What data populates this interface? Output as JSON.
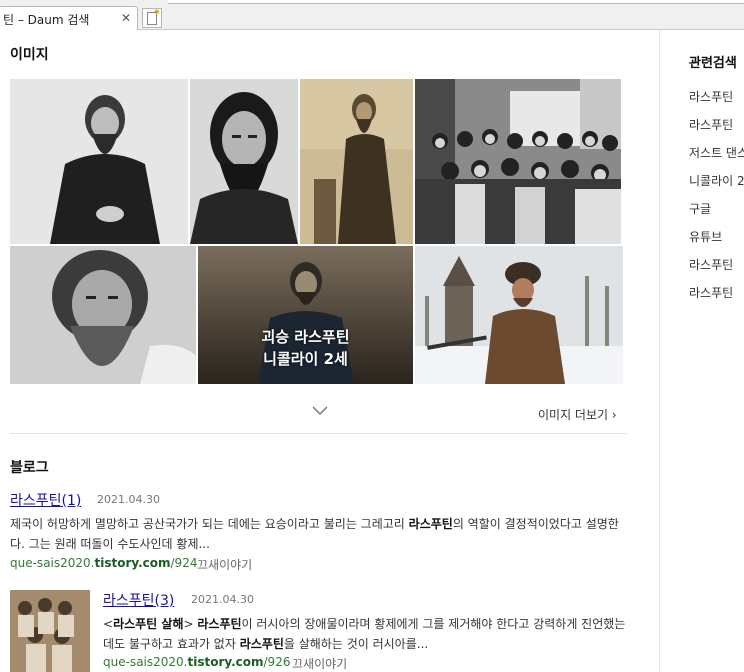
{
  "browser": {
    "tab_title": "틴 – Daum 검색",
    "tab_close": "✕"
  },
  "images_section": {
    "title": "이미지",
    "overlay_line1": "괴승 라스푸틴",
    "overlay_line2": "니콜라이 2세",
    "expand_icon": "chevron-down-icon",
    "more_label": "이미지 더보기 ›"
  },
  "blog_section": {
    "title": "블로그",
    "posts": [
      {
        "title": "라스푸틴(1)",
        "date": "2021.04.30",
        "snippet": [
          {
            "t": "제국이 허망하게 멸망하고 공산국가가 되는 데에는 요승이라고 불리는 그레고리 ",
            "b": false
          },
          {
            "t": "라스푸틴",
            "b": true
          },
          {
            "t": "의 역할이 결정적이었다고 설명한다. 그는 원래 떠돌이 수도사인데 황제...",
            "b": false
          }
        ],
        "url_prefix": "que-sais2020.",
        "url_domain": "tistory.com",
        "url_path": "/924",
        "author": "끄새이야기"
      },
      {
        "title": "라스푸틴(3)",
        "date": "2021.04.30",
        "snippet": [
          {
            "t": "<",
            "b": false
          },
          {
            "t": "라스푸틴 살해",
            "b": true
          },
          {
            "t": "> ",
            "b": false
          },
          {
            "t": "라스푸틴",
            "b": true
          },
          {
            "t": "이 러시아의 장애물이라며 황제에게 그를 제거해야 한다고 강력하게 진언했는데도 불구하고 효과가 없자 ",
            "b": false
          },
          {
            "t": "라스푸틴",
            "b": true
          },
          {
            "t": "을 살해하는 것이 러시아를...",
            "b": false
          }
        ],
        "url_prefix": "que-sais2020.",
        "url_domain": "tistory.com",
        "url_path": "/926",
        "author": "끄새이야기"
      }
    ]
  },
  "related": {
    "title": "관련검색",
    "items": [
      "라스푸틴 ",
      "라스푸틴 ",
      "저스트 댄스",
      "니콜라이 2",
      "구글",
      "유튜브",
      "라스푸틴 ",
      "라스푸틴 "
    ]
  }
}
